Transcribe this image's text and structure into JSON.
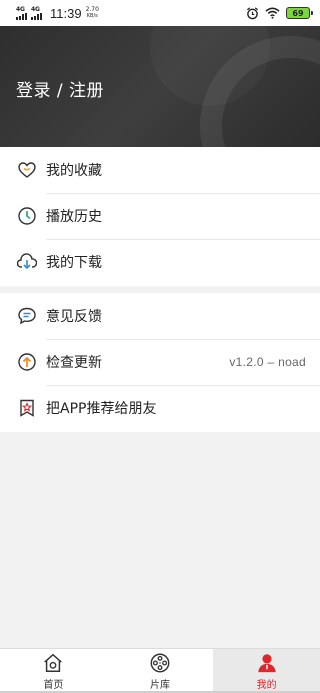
{
  "status_bar": {
    "net1": "4G",
    "net2": "4G",
    "time": "11:39",
    "speed_value": "2.70",
    "speed_unit": "KB/s",
    "battery": "69",
    "battery_color": "#7bd63a"
  },
  "header": {
    "login_label": "登录 / 注册"
  },
  "menu": {
    "items": [
      {
        "label": "我的收藏",
        "icon": "heart-icon"
      },
      {
        "label": "播放历史",
        "icon": "clock-icon"
      },
      {
        "label": "我的下载",
        "icon": "download-icon"
      },
      {
        "label": "意见反馈",
        "icon": "message-icon"
      },
      {
        "label": "检查更新",
        "icon": "upgrade-icon",
        "value": "v1.2.0 – noad"
      },
      {
        "label": "把APP推荐给朋友",
        "icon": "share-star-icon"
      }
    ]
  },
  "tabbar": {
    "tabs": [
      {
        "label": "首页",
        "icon": "home-icon"
      },
      {
        "label": "片库",
        "icon": "film-reel-icon"
      },
      {
        "label": "我的",
        "icon": "user-icon",
        "active": true
      }
    ],
    "active_color": "#e0262a"
  }
}
